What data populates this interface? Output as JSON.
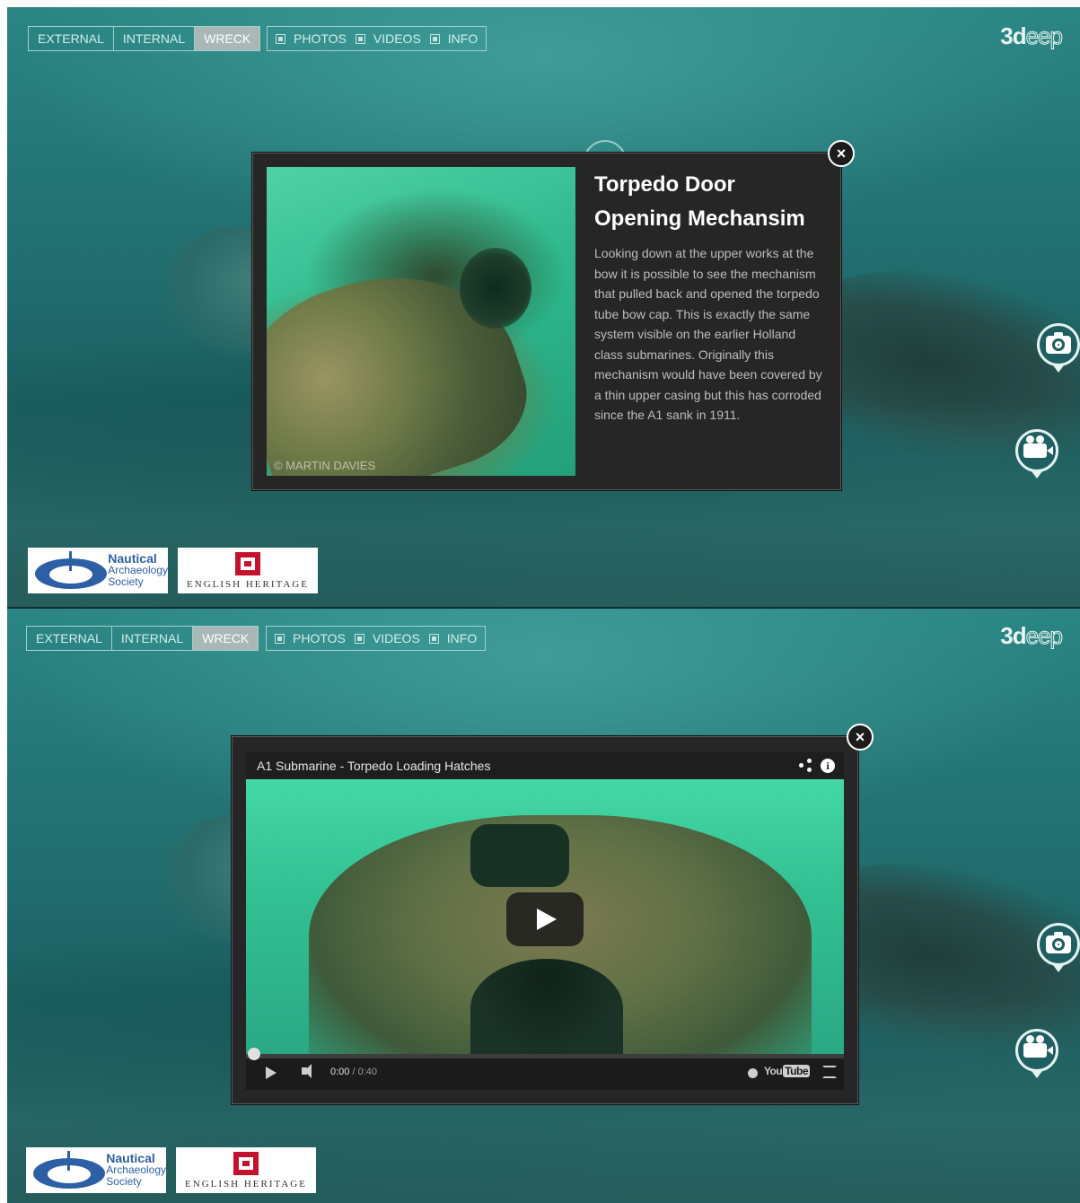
{
  "nav": {
    "views": [
      {
        "label": "EXTERNAL",
        "active": false
      },
      {
        "label": "INTERNAL",
        "active": false
      },
      {
        "label": "WRECK",
        "active": true
      }
    ],
    "toggles": [
      {
        "label": "PHOTOS"
      },
      {
        "label": "VIDEOS"
      },
      {
        "label": "INFO"
      }
    ]
  },
  "brand": {
    "part1": "3d",
    "part2": "eep"
  },
  "side_controls": {
    "camera_icon": "camera-icon",
    "video_icon": "video-camera-icon"
  },
  "logos": {
    "nas": {
      "line1": "Nautical",
      "line2": "Archaeology",
      "line3": "Society"
    },
    "eh": {
      "text": "ENGLISH HERITAGE"
    }
  },
  "info_modal": {
    "title_line1": "Torpedo Door",
    "title_line2": "Opening Mechansim",
    "body": "Looking down at the upper works at the bow it is possible to see the mechanism that pulled back and opened the torpedo tube bow cap. This is exactly the same system visible on the earlier Holland class submarines. Originally this mechanism would have been covered by a thin upper casing but this has corroded since the A1 sank in 1911.",
    "photo_credit": "© MARTIN DAVIES",
    "close_label": "×"
  },
  "video_modal": {
    "title": "A1 Submarine - Torpedo Loading Hatches",
    "time_current": "0:00",
    "time_duration": "/ 0:40",
    "progress": 0,
    "youtube_you": "You",
    "youtube_tube": "Tube",
    "info_glyph": "i",
    "close_label": "×"
  },
  "colors": {
    "water": "#226f70",
    "modal_bg": "#262626",
    "accent_red": "#c3122d",
    "accent_blue": "#2d5fa6"
  }
}
